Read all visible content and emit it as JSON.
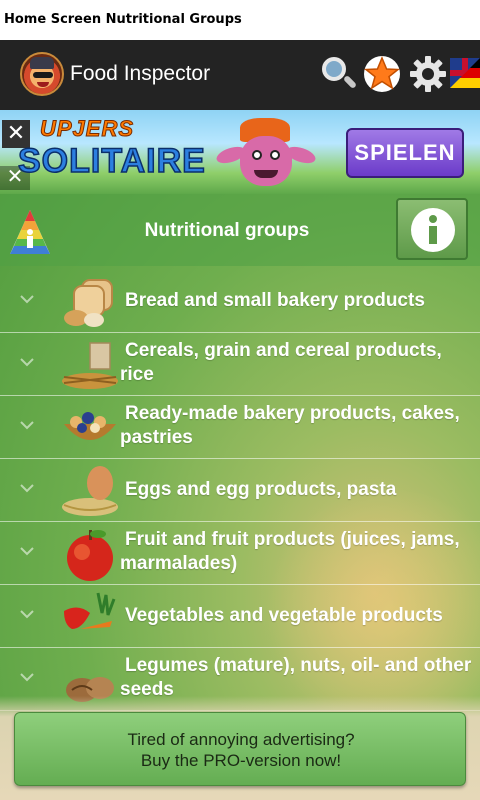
{
  "status_bar": {
    "title": "Home Screen Nutritional Groups"
  },
  "app_bar": {
    "title": "Food Inspector"
  },
  "ad": {
    "brand": "UPJERS",
    "product": "SOLITAIRE",
    "cta_label": "SPIELEN",
    "close_symbol": "✕"
  },
  "section": {
    "title": "Nutritional groups"
  },
  "list": {
    "items": [
      {
        "label": "Bread and small bakery products",
        "icon": "bread-icon"
      },
      {
        "label": "Cereals, grain and cereal products, rice",
        "icon": "cereal-icon"
      },
      {
        "label": "Ready-made bakery products, cakes, pastries",
        "icon": "pastry-icon"
      },
      {
        "label": "Eggs and egg products, pasta",
        "icon": "egg-icon"
      },
      {
        "label": "Fruit and fruit products (juices, jams, marmalades)",
        "icon": "apple-icon"
      },
      {
        "label": "Vegetables and vegetable products",
        "icon": "vegetables-icon"
      },
      {
        "label": "Legumes (mature), nuts, oil- and other seeds",
        "icon": "nuts-icon"
      }
    ]
  },
  "pro_banner": {
    "line1": "Tired of annoying advertising?",
    "line2": "Buy the PRO-version now!"
  },
  "colors": {
    "app_bar": "#232323",
    "content_green": "#6fae4e",
    "ad_cta": "#6b3bc9"
  }
}
